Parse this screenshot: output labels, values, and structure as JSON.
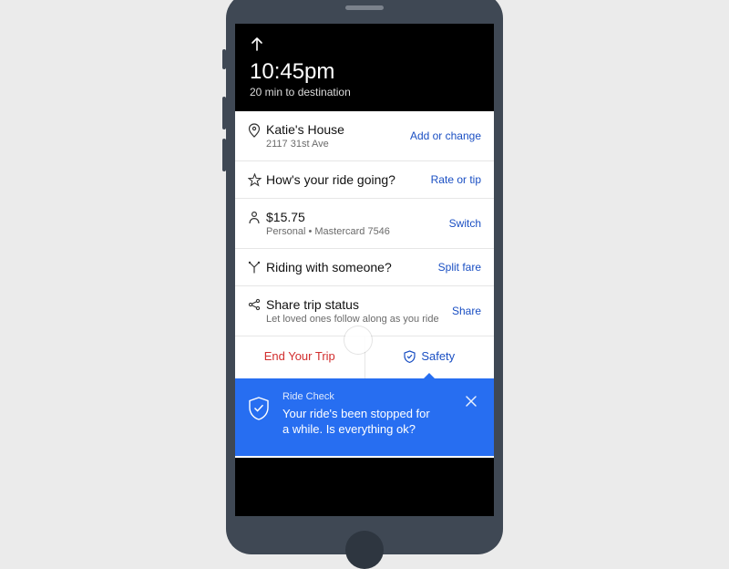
{
  "header": {
    "time": "10:45pm",
    "subtitle": "20 min to destination"
  },
  "rows": {
    "destination": {
      "title": "Katie's House",
      "subtitle": "2117 31st Ave",
      "action": "Add or change"
    },
    "rating": {
      "title": "How's your ride going?",
      "action": "Rate or tip"
    },
    "payment": {
      "title": "$15.75",
      "subtitle": "Personal • Mastercard 7546",
      "action": "Switch"
    },
    "split": {
      "title": "Riding with someone?",
      "action": "Split fare"
    },
    "share": {
      "title": "Share trip status",
      "subtitle": "Let loved ones follow along as you ride",
      "action": "Share"
    }
  },
  "buttons": {
    "end": "End Your Trip",
    "safety": "Safety"
  },
  "banner": {
    "title": "Ride Check",
    "text": "Your ride's been stopped for a while. Is everything ok?"
  }
}
